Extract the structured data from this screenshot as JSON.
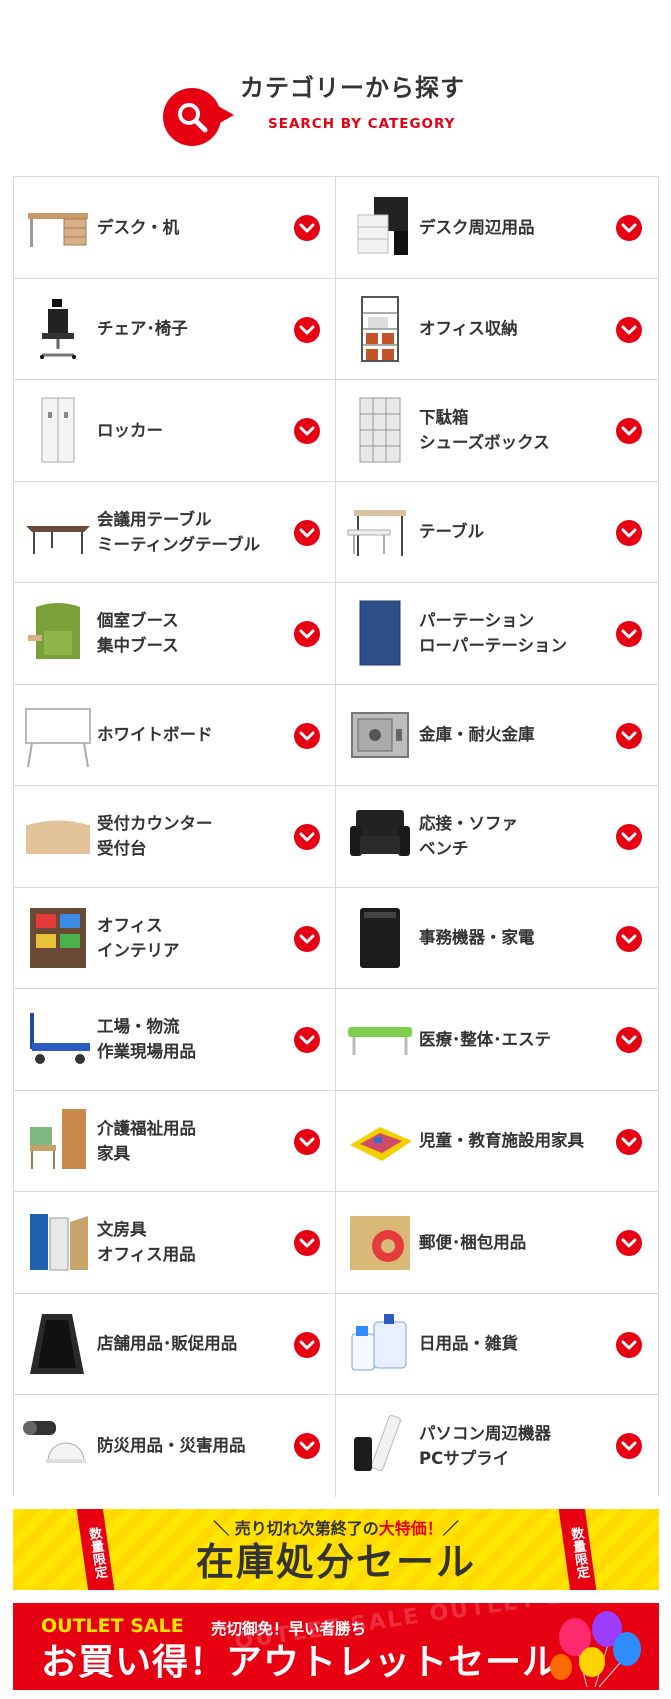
{
  "header": {
    "title": "カテゴリーから探す",
    "subtitle": "SEARCH BY CATEGORY",
    "icon": "search-icon"
  },
  "categories": [
    {
      "line1": "デスク・机",
      "line2": "",
      "thumb": "desk"
    },
    {
      "line1": "デスク周辺用品",
      "line2": "",
      "thumb": "wagon"
    },
    {
      "line1": "チェア･椅子",
      "line2": "",
      "thumb": "chair"
    },
    {
      "line1": "オフィス収納",
      "line2": "",
      "thumb": "shelf"
    },
    {
      "line1": "ロッカー",
      "line2": "",
      "thumb": "locker"
    },
    {
      "line1": "下駄箱",
      "line2": "シューズボックス",
      "thumb": "shoebox"
    },
    {
      "line1": "会議用テーブル",
      "line2": "ミーティングテーブル",
      "thumb": "foldtable"
    },
    {
      "line1": "テーブル",
      "line2": "",
      "thumb": "table"
    },
    {
      "line1": "個室ブース",
      "line2": "集中ブース",
      "thumb": "booth"
    },
    {
      "line1": "パーテーション",
      "line2": "ローパーテーション",
      "thumb": "partition"
    },
    {
      "line1": "ホワイトボード",
      "line2": "",
      "thumb": "whiteboard"
    },
    {
      "line1": "金庫・耐火金庫",
      "line2": "",
      "thumb": "safe"
    },
    {
      "line1": "受付カウンター",
      "line2": "受付台",
      "thumb": "counter"
    },
    {
      "line1": "応接・ソファ",
      "line2": "ベンチ",
      "thumb": "sofa"
    },
    {
      "line1": "オフィス",
      "line2": "インテリア",
      "thumb": "magazine"
    },
    {
      "line1": "事務機器・家電",
      "line2": "",
      "thumb": "shredder"
    },
    {
      "line1": "工場・物流",
      "line2": "作業現場用品",
      "thumb": "cart"
    },
    {
      "line1": "医療･整体･エステ",
      "line2": "",
      "thumb": "bed"
    },
    {
      "line1": "介護福祉用品",
      "line2": "家具",
      "thumb": "care"
    },
    {
      "line1": "児童・教育施設用家具",
      "line2": "",
      "thumb": "mat"
    },
    {
      "line1": "文房具",
      "line2": "オフィス用品",
      "thumb": "files"
    },
    {
      "line1": "郵便･梱包用品",
      "line2": "",
      "thumb": "tape"
    },
    {
      "line1": "店舗用品･販促用品",
      "line2": "",
      "thumb": "aboard"
    },
    {
      "line1": "日用品・雑貨",
      "line2": "",
      "thumb": "bottles"
    },
    {
      "line1": "防災用品・災害用品",
      "line2": "",
      "thumb": "helmet"
    },
    {
      "line1": "パソコン周辺機器",
      "line2": "PCサプライ",
      "thumb": "power"
    }
  ],
  "banner_stock": {
    "sub_prefix": "＼ 売り切れ次第終了の",
    "sub_highlight": "大特価！",
    "sub_suffix": "／",
    "main": "在庫処分セール",
    "corner": "数量限定"
  },
  "banner_outlet": {
    "en": "OUTLET SALE",
    "top": "売切御免！早い者勝ち",
    "main": "お買い得！アウトレットセール",
    "ghost": "OUTLET SALE OUTLET SALE"
  },
  "colors": {
    "accent": "#e60012",
    "yellow": "#ffe600",
    "text": "#333333",
    "border": "#d9d9d9"
  }
}
